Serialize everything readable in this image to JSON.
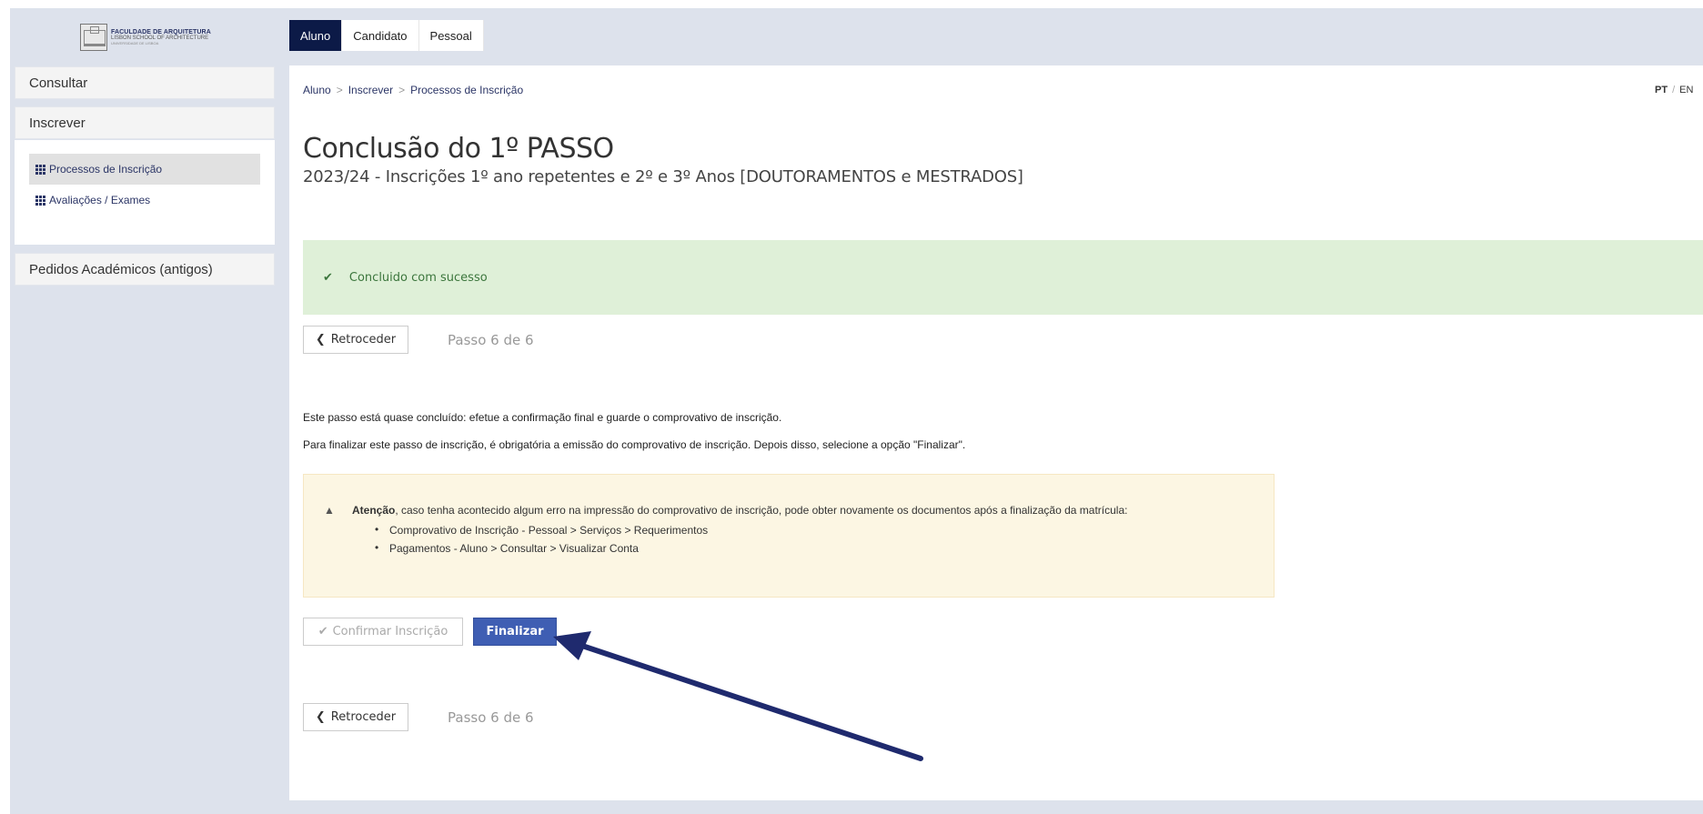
{
  "logo": {
    "line1": "FACULDADE DE ARQUITETURA",
    "line2": "LISBON SCHOOL OF ARCHITECTURE",
    "line3": "UNIVERSIDADE DE LISBOA"
  },
  "tabs": [
    {
      "label": "Aluno",
      "active": true
    },
    {
      "label": "Candidato",
      "active": false
    },
    {
      "label": "Pessoal",
      "active": false
    }
  ],
  "sidebar": {
    "consultar": "Consultar",
    "inscrever": "Inscrever",
    "items": [
      {
        "label": "Processos de Inscrição",
        "icon": "grid-icon",
        "active": true
      },
      {
        "label": "Avaliações / Exames",
        "icon": "grid-icon",
        "active": false
      }
    ],
    "pedidos": "Pedidos Académicos (antigos)"
  },
  "breadcrumb": {
    "items": [
      "Aluno",
      "Inscrever",
      "Processos de Inscrição"
    ],
    "separator": ">"
  },
  "lang": {
    "pt": "PT",
    "sep": "/",
    "en": "EN"
  },
  "page": {
    "title": "Conclusão do 1º PASSO",
    "subtitle": "2023/24 - Inscrições 1º ano repetentes e 2º e 3º Anos [DOUTORAMENTOS e MESTRADOS]"
  },
  "success": {
    "icon": "check-icon",
    "text": "Concluido com sucesso"
  },
  "nav": {
    "back_label": "Retroceder",
    "step_label": "Passo 6 de 6"
  },
  "content": {
    "para1": "Este passo está quase concluído: efetue a confirmação final e guarde o comprovativo de inscrição.",
    "para2": "Para finalizar este passo de inscrição, é obrigatória a emissão do comprovativo de inscrição. Depois disso, selecione a opção \"Finalizar\"."
  },
  "warning": {
    "icon": "warning-icon",
    "bold": "Atenção",
    "text": ", caso tenha acontecido algum erro na impressão do comprovativo de inscrição, pode obter novamente os documentos após a finalização da matrícula:",
    "items": [
      "Comprovativo de Inscrição - Pessoal > Serviços > Requerimentos",
      "Pagamentos - Aluno > Consultar > Visualizar Conta"
    ]
  },
  "actions": {
    "confirm_label": "Confirmar Inscrição",
    "finalizar_label": "Finalizar"
  },
  "colors": {
    "nav_active": "#0c1a47",
    "primary_button": "#3f5eb3",
    "success_bg": "#dff0d8",
    "warning_bg": "#fcf6e3",
    "annotation_arrow": "#1f2a6e"
  }
}
